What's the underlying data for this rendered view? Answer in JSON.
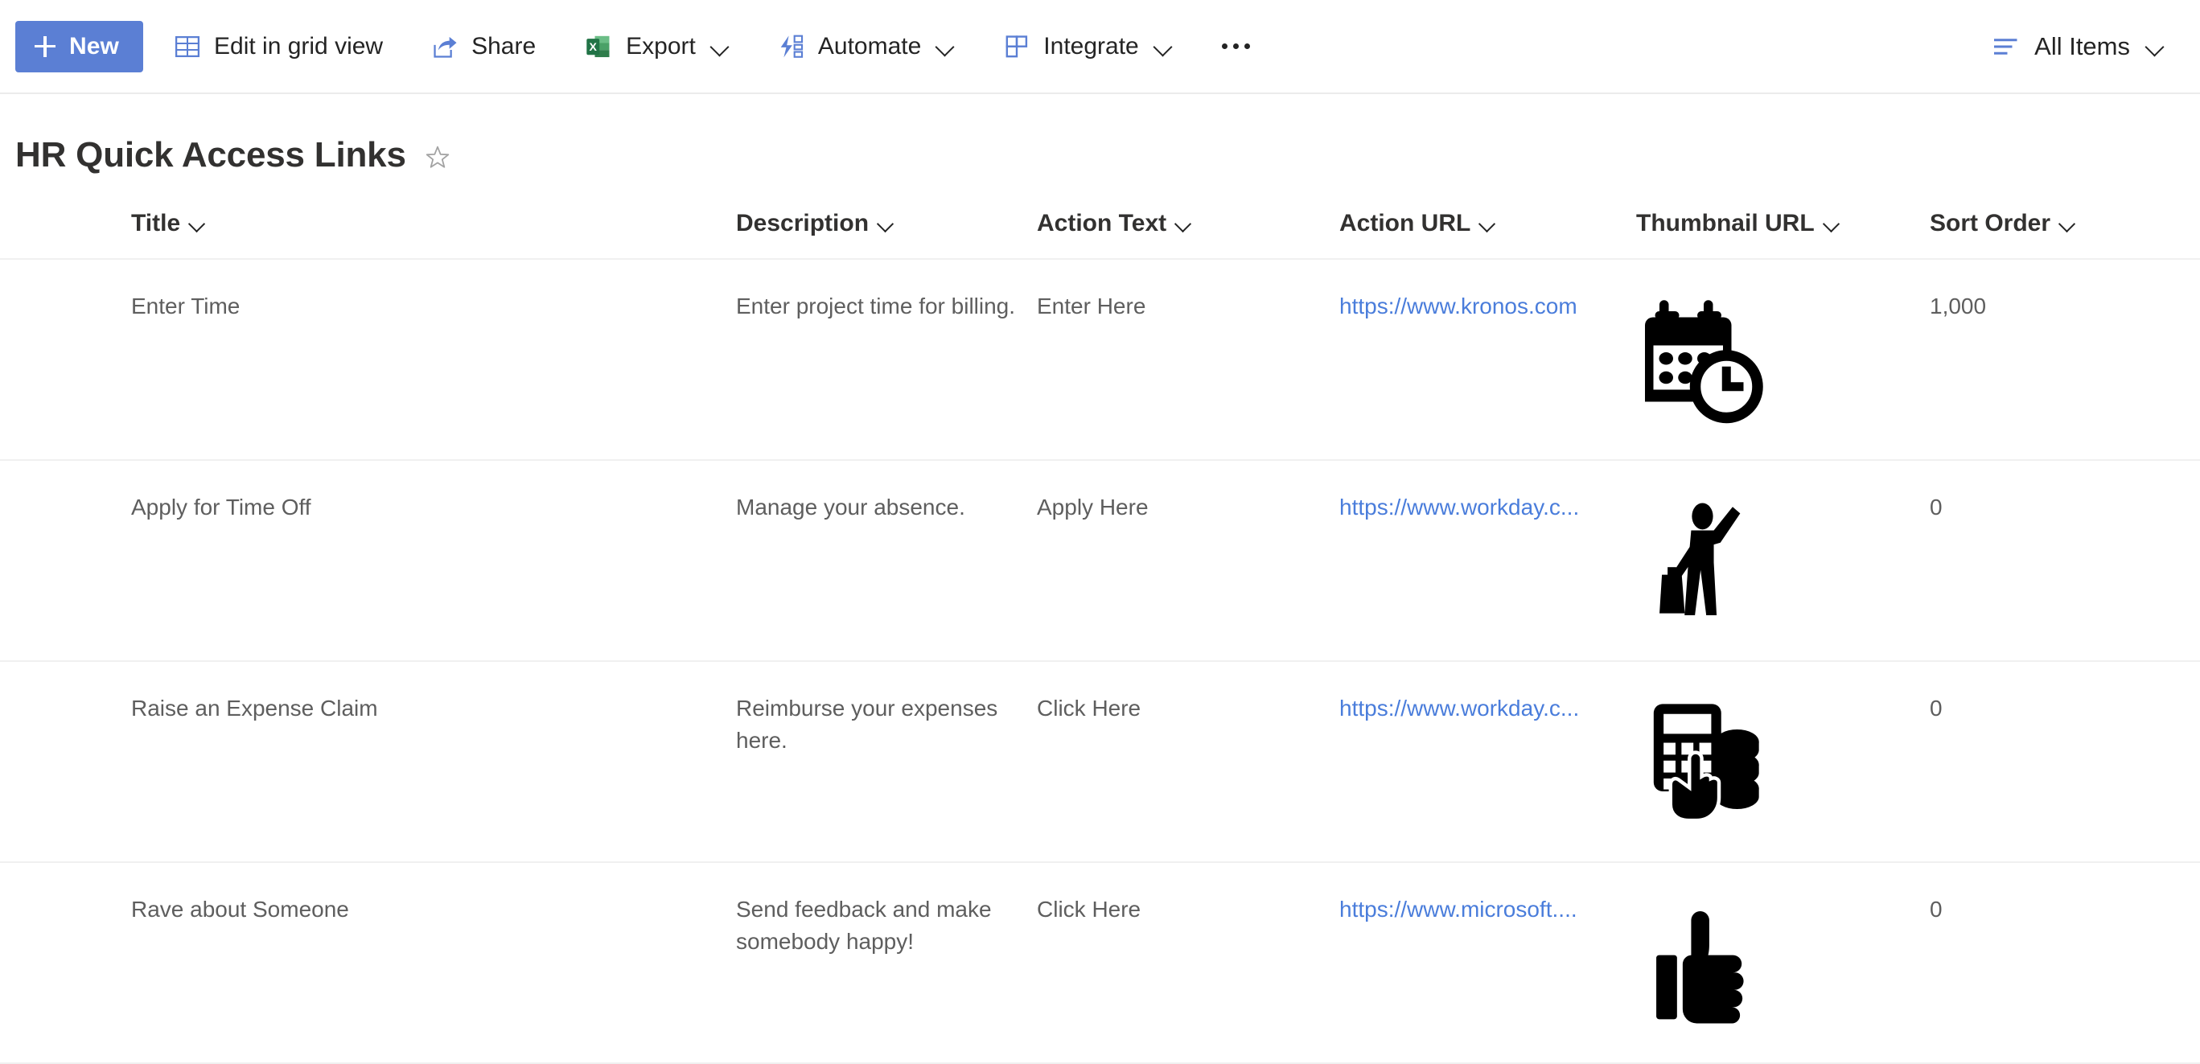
{
  "commandbar": {
    "new_label": "New",
    "items": [
      {
        "label": "Edit in grid view",
        "icon": "grid-icon",
        "chevron": false
      },
      {
        "label": "Share",
        "icon": "share-icon",
        "chevron": false
      },
      {
        "label": "Export",
        "icon": "excel-icon",
        "chevron": true
      },
      {
        "label": "Automate",
        "icon": "automate-icon",
        "chevron": true
      },
      {
        "label": "Integrate",
        "icon": "integrate-icon",
        "chevron": true
      }
    ],
    "overflow_label": "More options",
    "view_label": "All Items"
  },
  "header": {
    "title": "HR Quick Access Links",
    "favorite_label": "Add to favorites"
  },
  "table": {
    "columns": [
      {
        "label": "Title"
      },
      {
        "label": "Description"
      },
      {
        "label": "Action Text"
      },
      {
        "label": "Action URL"
      },
      {
        "label": "Thumbnail URL"
      },
      {
        "label": "Sort Order"
      }
    ],
    "rows": [
      {
        "title": "Enter Time",
        "description": "Enter project time for billing.",
        "action_text": "Enter Here",
        "action_url": "https://www.kronos.com",
        "thumbnail_icon": "calendar-clock-icon",
        "sort_order": "1,000"
      },
      {
        "title": "Apply for Time Off",
        "description": "Manage your absence.",
        "action_text": "Apply Here",
        "action_url": "https://www.workday.c...",
        "thumbnail_icon": "traveler-luggage-icon",
        "sort_order": "0"
      },
      {
        "title": "Raise an Expense Claim",
        "description": "Reimburse your expenses here.",
        "action_text": "Click Here",
        "action_url": "https://www.workday.c...",
        "thumbnail_icon": "calculator-coins-icon",
        "sort_order": "0"
      },
      {
        "title": "Rave about Someone",
        "description": "Send feedback and make somebody happy!",
        "action_text": "Click Here",
        "action_url": "https://www.microsoft....",
        "thumbnail_icon": "thumbs-up-icon",
        "sort_order": "0"
      }
    ]
  },
  "colors": {
    "accent": "#5b7fd4",
    "link": "#4a7ddb",
    "excel_green": "#217346",
    "divider": "#f0f0f0",
    "text": "#323130",
    "muted_text": "#5e5e5e"
  }
}
